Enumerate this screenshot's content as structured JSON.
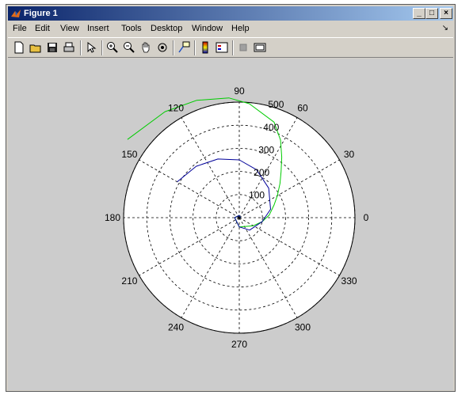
{
  "window": {
    "title": "Figure 1"
  },
  "menu": {
    "items": [
      "File",
      "Edit",
      "View",
      "Insert",
      "Tools",
      "Desktop",
      "Window",
      "Help"
    ]
  },
  "toolbar": {
    "buttons": [
      "new-figure-icon",
      "open-file-icon",
      "save-icon",
      "print-icon",
      "edit-plot-arrow-icon",
      "zoom-in-icon",
      "zoom-out-icon",
      "pan-hand-icon",
      "rotate-3d-icon",
      "data-cursor-icon",
      "colorbar-icon",
      "legend-icon",
      "hide-plot-tools-icon",
      "show-plot-tools-icon"
    ]
  },
  "chart_data": {
    "type": "line",
    "coordinate_system": "polar",
    "theta_ticks_deg": [
      "0",
      "30",
      "60",
      "90",
      "120",
      "150",
      "180",
      "210",
      "240",
      "270",
      "300",
      "330"
    ],
    "r_ticks": [
      "100",
      "200",
      "300",
      "400",
      "500"
    ],
    "rlim": [
      0,
      500
    ],
    "grid": true,
    "series": [
      {
        "color": "#00cc00",
        "description": "outer spiral",
        "r": [
          5,
          10,
          20,
          40,
          70,
          100,
          130,
          160,
          190,
          230,
          270,
          320,
          380,
          440,
          495,
          520,
          540,
          560,
          590
        ],
        "theta_deg": [
          0,
          90,
          180,
          270,
          330,
          350,
          5,
          20,
          30,
          40,
          48,
          55,
          62,
          70,
          85,
          95,
          110,
          125,
          145
        ]
      },
      {
        "color": "#000099",
        "description": "inner spiral",
        "r": [
          5,
          10,
          20,
          40,
          70,
          100,
          140,
          180,
          220,
          250,
          270,
          290,
          310
        ],
        "theta_deg": [
          0,
          90,
          180,
          270,
          310,
          350,
          15,
          45,
          70,
          90,
          110,
          130,
          150
        ]
      }
    ]
  }
}
